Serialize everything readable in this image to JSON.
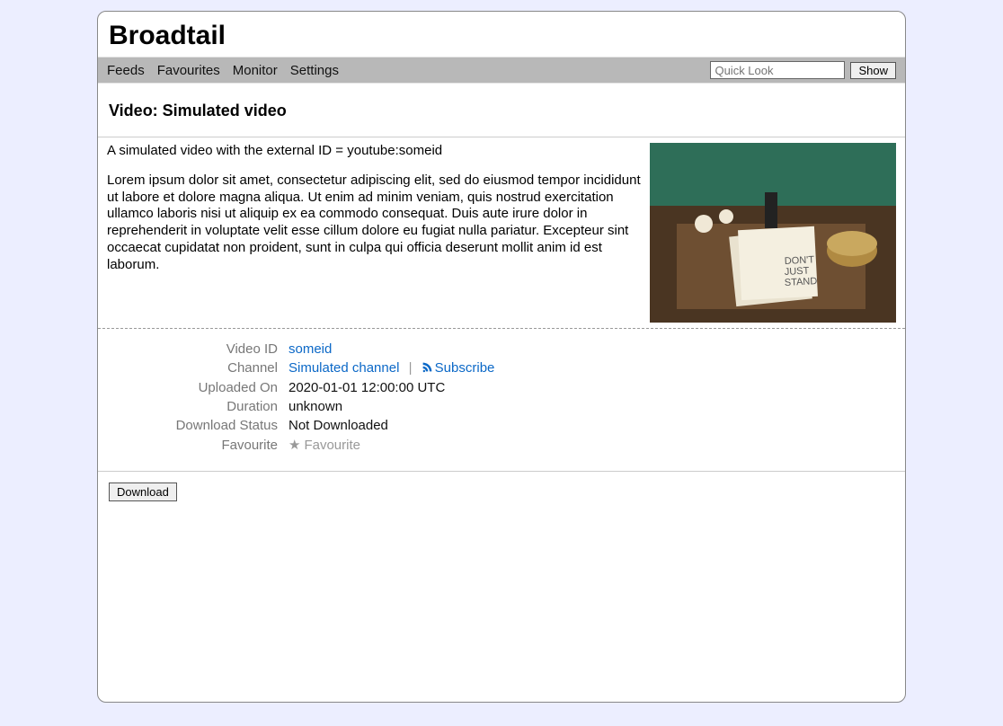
{
  "app": {
    "title": "Broadtail"
  },
  "nav": {
    "links": [
      "Feeds",
      "Favourites",
      "Monitor",
      "Settings"
    ],
    "quicklook_placeholder": "Quick Look",
    "show_label": "Show"
  },
  "page": {
    "title": "Video: Simulated video"
  },
  "description": {
    "line1": "A simulated video with the external ID = youtube:someid",
    "body": "Lorem ipsum dolor sit amet, consectetur adipiscing elit, sed do eiusmod tempor incididunt ut labore et dolore magna aliqua. Ut enim ad minim veniam, quis nostrud exercitation ullamco laboris nisi ut aliquip ex ea commodo consequat. Duis aute irure dolor in reprehenderit in voluptate velit esse cillum dolore eu fugiat nulla pariatur. Excepteur sint occaecat cupidatat non proident, sunt in culpa qui officia deserunt mollit anim id est laborum."
  },
  "details": {
    "video_id": {
      "label": "Video ID",
      "value": "someid"
    },
    "channel": {
      "label": "Channel",
      "value": "Simulated channel",
      "subscribe": "Subscribe"
    },
    "uploaded": {
      "label": "Uploaded On",
      "value": "2020-01-01 12:00:00 UTC"
    },
    "duration": {
      "label": "Duration",
      "value": "unknown"
    },
    "download_status": {
      "label": "Download Status",
      "value": "Not Downloaded"
    },
    "favourite": {
      "label": "Favourite",
      "value": "Favourite"
    }
  },
  "actions": {
    "download": "Download"
  }
}
